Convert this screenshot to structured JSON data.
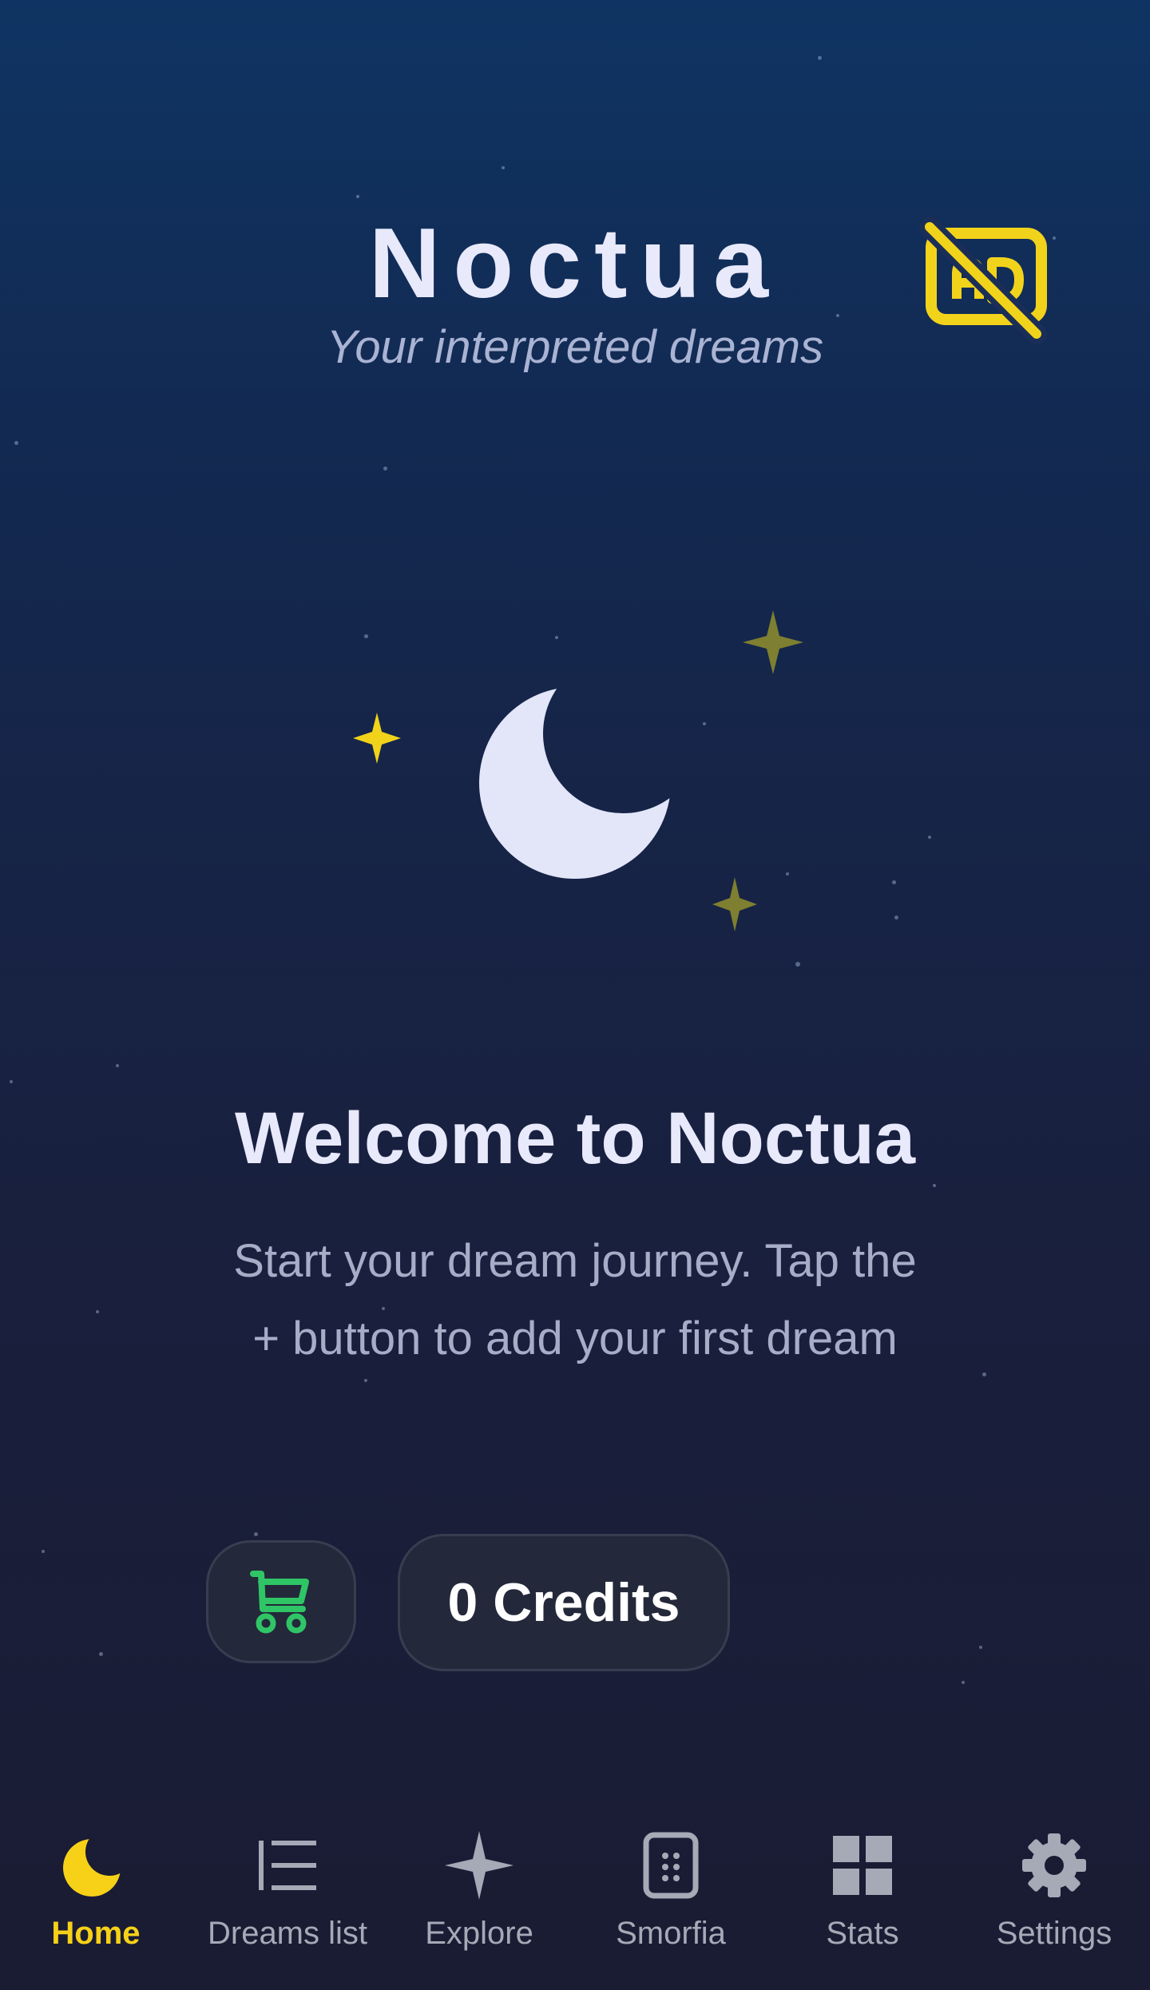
{
  "app": {
    "title": "Noctua",
    "subtitle": "Your interpreted dreams"
  },
  "header": {
    "ad_toggle_icon": "ads-off-icon",
    "accent_color": "#f2d31b"
  },
  "empty_state": {
    "heading": "Welcome to Noctua",
    "message": "Start your dream journey. Tap the + button to add your first dream"
  },
  "actions": {
    "cart_icon": "cart-icon",
    "cart_color": "#2fc566",
    "credits_label": "0 Credits"
  },
  "nav": {
    "items": [
      {
        "label": "Home",
        "icon": "moon-icon",
        "active": true
      },
      {
        "label": "Dreams list",
        "icon": "list-icon",
        "active": false
      },
      {
        "label": "Explore",
        "icon": "sparkle-icon",
        "active": false
      },
      {
        "label": "Smorfia",
        "icon": "book-icon",
        "active": false
      },
      {
        "label": "Stats",
        "icon": "grid-icon",
        "active": false
      },
      {
        "label": "Settings",
        "icon": "gear-icon",
        "active": false
      }
    ],
    "active_color": "#f7d117",
    "inactive_color": "#a6a9b6"
  }
}
